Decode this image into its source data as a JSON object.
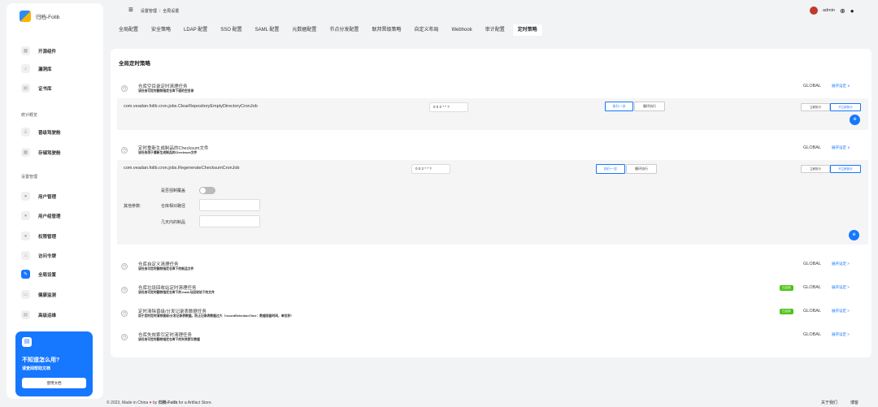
{
  "app": {
    "name": "归档-Folib"
  },
  "sidebar": {
    "items": [
      {
        "label": "开源组件",
        "icon": "grid-icon"
      },
      {
        "label": "漏洞库",
        "icon": "home-icon"
      },
      {
        "label": "证书库",
        "icon": "file-icon"
      }
    ],
    "section_stats": "统计概览",
    "stats_items": [
      {
        "label": "晋级驾驶舱",
        "icon": "user-icon"
      },
      {
        "label": "存储驾驶舱",
        "icon": "grid-icon"
      }
    ],
    "section_settings": "设置管理",
    "settings_items": [
      {
        "label": "用户管理",
        "icon": "user-icon"
      },
      {
        "label": "用户组管理",
        "icon": "users-icon"
      },
      {
        "label": "权限管理",
        "icon": "shield-icon"
      },
      {
        "label": "访问令牌",
        "icon": "lock-icon"
      },
      {
        "label": "全局设置",
        "icon": "wrench-icon"
      },
      {
        "label": "健康监测",
        "icon": "monitor-icon"
      },
      {
        "label": "高级运维",
        "icon": "tools-icon"
      }
    ],
    "help": {
      "title": "不知道怎么用?",
      "subtitle": "请查阅帮助文档",
      "button": "使用文档"
    }
  },
  "header": {
    "breadcrumb_parent": "设置管理",
    "breadcrumb_sep": "/",
    "breadcrumb_current": "全局设置",
    "user": "admin"
  },
  "tabs": [
    "全局配置",
    "安全策略",
    "LDAP 配置",
    "SSO 配置",
    "SAML 配置",
    "元数据配置",
    "节点分发配置",
    "联邦晋级策略",
    "自定义布局",
    "Webhook",
    "审计配置",
    "定时策略"
  ],
  "card": {
    "title": "全局定时策略",
    "tasks": [
      {
        "name": "仓库空目录定时清理任务",
        "desc": "该任务可定时删除指定仓库下面的空目录",
        "badge": "",
        "scope": "GLOBAL",
        "expand": "展开设定 ∨"
      },
      {
        "name": "定时重新生成制品的Checksum文件",
        "desc": "该任务用于重新生成制品的Checksum文件",
        "badge": "",
        "scope": "GLOBAL",
        "expand": "展开设定 ∨"
      },
      {
        "name": "仓库自定义清理任务",
        "desc": "该任务可定时删除指定仓库下的制品文件",
        "badge": "",
        "scope": "GLOBAL",
        "expand": "展开设定 >"
      },
      {
        "name": "仓库垃圾回收站定时清理任务",
        "desc": "该任务可定时删除指定仓库下的.trash与回收站下的文件",
        "badge": "已启用",
        "scope": "GLOBAL",
        "expand": "展开设定 >"
      },
      {
        "name": "定时清除晋级/分发记录表数据任务",
        "desc": "用于定时定时清除晋级/分发记录表数据。防止记录表数据过大（recordRetentionTime：数据保留时间，单位秒）",
        "badge": "已启用",
        "scope": "GLOBAL",
        "expand": "展开设定 >"
      },
      {
        "name": "仓库失效索引定时清理任务",
        "desc": "该任务可定时删除指定仓库下的失效索引数据",
        "badge": "",
        "scope": "GLOBAL",
        "expand": "展开设定 >"
      }
    ],
    "expanded": [
      {
        "class": "com.veadan.folib.cron.jobs.ClearRepositoryEmptyDirectoryCronJob",
        "cron": "0 0 2 * * ?",
        "run_once": "执行一次",
        "loop_run": "循环执行",
        "run_now": "立即执行",
        "no_run": "不立即执行",
        "fab": "⊕"
      },
      {
        "class": "com.veadan.folib.cron.jobs.RegenerateChecksumCronJob",
        "cron": "0 0 2 * * ?",
        "run_once": "执行一次",
        "loop_run": "循环执行",
        "run_now": "立即执行",
        "no_run": "不立即执行",
        "fab": "⊕"
      }
    ],
    "params": {
      "label": "其他参数:",
      "force": "是否强制覆盖",
      "path": "仓库相对路径",
      "exclude": "几天内的制品",
      "force_value": false
    }
  },
  "footer": {
    "prefix": "© 2023, Made in China",
    "heart": "♥",
    "by": "by",
    "brand": "归档-Folib",
    "suffix": "for a Artifact Store.",
    "about": "关于我们",
    "blog": "博客"
  }
}
